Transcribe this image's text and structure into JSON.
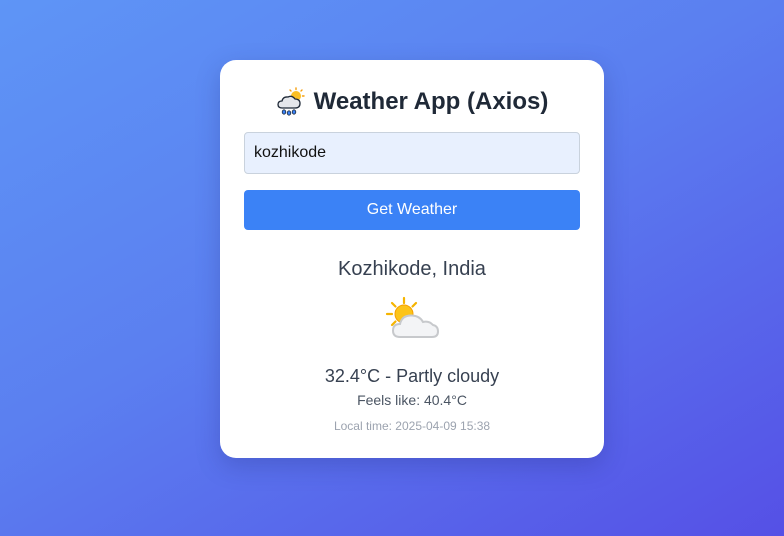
{
  "app": {
    "title": "Weather App (Axios)",
    "title_icon": "cloud-rain-sun-icon"
  },
  "search": {
    "value": "kozhikode",
    "button_label": "Get Weather"
  },
  "result": {
    "location": "Kozhikode, India",
    "condition_icon": "partly-cloudy-icon",
    "temp_condition": "32.4°C - Partly cloudy",
    "feels_like": "Feels like: 40.4°C",
    "local_time": "Local time: 2025-04-09 15:38"
  },
  "colors": {
    "background_start": "#5e95f6",
    "background_end": "#5550e6",
    "button": "#3b82f6",
    "input_bg": "#e8f0fe",
    "title_text": "#1f2937"
  }
}
